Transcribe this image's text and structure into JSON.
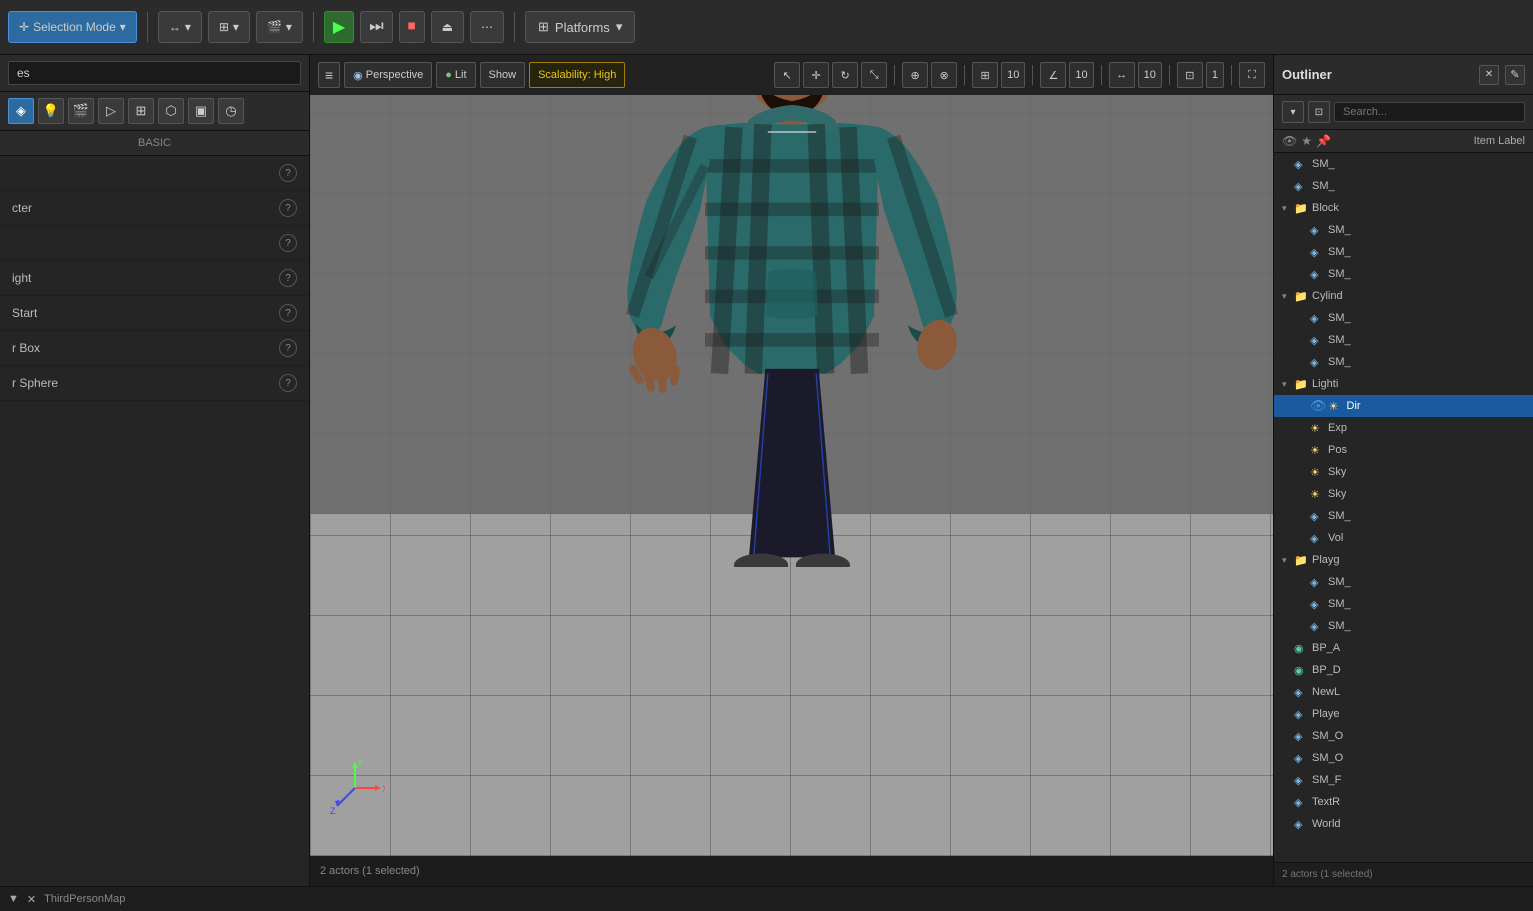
{
  "title_bar": {
    "title": "ThirdPersonMap"
  },
  "toolbar": {
    "selection_mode_label": "Selection Mode",
    "play_label": "▶",
    "advance_play_label": "⏭",
    "stop_label": "⏹",
    "eject_label": "⏏",
    "more_label": "⋯",
    "platforms_label": "Platforms",
    "chevron": "▾"
  },
  "left_panel": {
    "search_placeholder": "es",
    "basic_label": "BASIC",
    "items": [
      {
        "name": "",
        "has_info": true
      },
      {
        "name": "cter",
        "has_info": true
      },
      {
        "name": "",
        "has_info": true
      },
      {
        "name": "ight",
        "has_info": true
      },
      {
        "name": "Start",
        "has_info": true
      },
      {
        "name": "r Box",
        "has_info": true
      },
      {
        "name": "r Sphere",
        "has_info": true
      }
    ]
  },
  "viewport": {
    "menu_btn": "≡",
    "perspective_label": "Perspective",
    "lit_label": "Lit",
    "show_label": "Show",
    "scalability_label": "Scalability: High",
    "grid_size": "10",
    "angle": "10",
    "dist": "10",
    "layer": "1",
    "status_text": "2 actors (1 selected)"
  },
  "outliner": {
    "title": "Outliner",
    "search_placeholder": "Search...",
    "item_label": "Item Label",
    "close_label": "✕",
    "edit_label": "✎",
    "items": [
      {
        "indent": 0,
        "type": "sm",
        "label": "SM_",
        "arrow": ""
      },
      {
        "indent": 0,
        "type": "sm",
        "label": "SM_",
        "arrow": ""
      },
      {
        "indent": 0,
        "type": "folder",
        "label": "Block",
        "arrow": "▾"
      },
      {
        "indent": 1,
        "type": "sm",
        "label": "SM_",
        "arrow": ""
      },
      {
        "indent": 1,
        "type": "sm",
        "label": "SM_",
        "arrow": ""
      },
      {
        "indent": 1,
        "type": "sm",
        "label": "SM_",
        "arrow": ""
      },
      {
        "indent": 0,
        "type": "folder",
        "label": "Cylind",
        "arrow": "▾"
      },
      {
        "indent": 1,
        "type": "sm",
        "label": "SM_",
        "arrow": ""
      },
      {
        "indent": 1,
        "type": "sm",
        "label": "SM_",
        "arrow": ""
      },
      {
        "indent": 1,
        "type": "sm",
        "label": "SM_",
        "arrow": ""
      },
      {
        "indent": 0,
        "type": "folder",
        "label": "Lighti",
        "arrow": "▾"
      },
      {
        "indent": 1,
        "type": "light",
        "label": "Dir",
        "arrow": "",
        "selected": true
      },
      {
        "indent": 1,
        "type": "light",
        "label": "Exp",
        "arrow": ""
      },
      {
        "indent": 1,
        "type": "light",
        "label": "Pos",
        "arrow": ""
      },
      {
        "indent": 1,
        "type": "light",
        "label": "Sky",
        "arrow": ""
      },
      {
        "indent": 1,
        "type": "light",
        "label": "Sky",
        "arrow": ""
      },
      {
        "indent": 1,
        "type": "sm",
        "label": "SM_",
        "arrow": ""
      },
      {
        "indent": 1,
        "type": "sm",
        "label": "Vol",
        "arrow": ""
      },
      {
        "indent": 0,
        "type": "folder",
        "label": "Playg",
        "arrow": "▾"
      },
      {
        "indent": 1,
        "type": "sm",
        "label": "SM_",
        "arrow": ""
      },
      {
        "indent": 1,
        "type": "sm",
        "label": "SM_",
        "arrow": ""
      },
      {
        "indent": 1,
        "type": "sm",
        "label": "SM_",
        "arrow": ""
      },
      {
        "indent": 0,
        "type": "bp",
        "label": "BP_A",
        "arrow": ""
      },
      {
        "indent": 0,
        "type": "bp",
        "label": "BP_D",
        "arrow": ""
      },
      {
        "indent": 0,
        "type": "sm",
        "label": "NewL",
        "arrow": ""
      },
      {
        "indent": 0,
        "type": "sm",
        "label": "Playe",
        "arrow": ""
      },
      {
        "indent": 0,
        "type": "sm",
        "label": "SM_O",
        "arrow": ""
      },
      {
        "indent": 0,
        "type": "sm",
        "label": "SM_O",
        "arrow": ""
      },
      {
        "indent": 0,
        "type": "sm",
        "label": "SM_F",
        "arrow": ""
      },
      {
        "indent": 0,
        "type": "sm",
        "label": "TextR",
        "arrow": ""
      },
      {
        "indent": 0,
        "type": "sm",
        "label": "World",
        "arrow": ""
      }
    ],
    "status": "2 actors (1 selected)"
  },
  "status_bar": {
    "item1": "▼",
    "item2": "✕",
    "label": "ThirdPersonMap"
  },
  "colors": {
    "accent_blue": "#2d6a9f",
    "selected_blue": "#1a5a9f",
    "play_green": "#2d6a2d",
    "scalability_yellow": "#e6c619",
    "folder_gold": "#c8a040",
    "sm_blue": "#7ab8e8",
    "light_yellow": "#ffe070",
    "bp_teal": "#5ec8a0"
  }
}
